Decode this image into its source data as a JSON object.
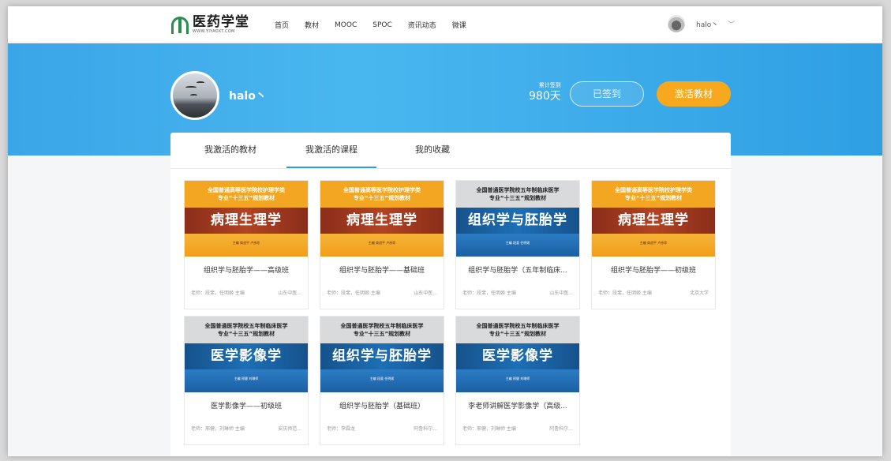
{
  "nav": {
    "logo_cn": "医药学堂",
    "logo_url": "WWW.YIYAOXT.COM",
    "links": [
      "首页",
      "教材",
      "MOOC",
      "SPOC",
      "资讯动态",
      "微课"
    ],
    "username": "halo丶"
  },
  "banner": {
    "username": "halo丶",
    "sign_label": "累计签到",
    "sign_days": "980天",
    "signed_label": "已签到",
    "activate_label": "激活教材"
  },
  "tabs": [
    "我激活的教材",
    "我激活的课程",
    "我的收藏"
  ],
  "active_tab": "我激活的课程",
  "courses": [
    {
      "cover_style": "orange",
      "cover_top": "全国普通高等医学院校护理学类\n专业“十三五”规划教材",
      "cover_title": "病理生理学",
      "cover_authors": "主编 商战平 卢彦珍",
      "title": "组织学与胚胎学——高级班",
      "teacher": "老师：段斐，任明姬 主编",
      "school": "山东中医..."
    },
    {
      "cover_style": "orange",
      "cover_top": "全国普通高等医学院校护理学类\n专业“十三五”规划教材",
      "cover_title": "病理生理学",
      "cover_authors": "主编 商战平 卢彦珍",
      "title": "组织学与胚胎学——基础班",
      "teacher": "老师：段斐，任明姬 主编",
      "school": "山东中医..."
    },
    {
      "cover_style": "blue",
      "cover_top": "全国普通医学院校五年制临床医学\n专业“十三五”规划教材",
      "cover_title": "组织学与胚胎学",
      "cover_authors": "主编 段斐 任明姬",
      "title": "组织学与胚胎学（五年制临床...",
      "teacher": "老师：段斐，任明姬 主编",
      "school": "山东中医..."
    },
    {
      "cover_style": "orange",
      "cover_top": "全国普通高等医学院校护理学类\n专业“十三五”规划教材",
      "cover_title": "病理生理学",
      "cover_authors": "主编 商战平 卢彦珍",
      "title": "组织学与胚胎学——初级班",
      "teacher": "老师：段斐，任明姬 主编",
      "school": "北京大学"
    },
    {
      "cover_style": "blue",
      "cover_top": "全国普通医学院校五年制临床医学\n专业“十三五”规划教材",
      "cover_title": "医学影像学",
      "cover_authors": "主编 邢健 刘琳师",
      "title": "医学影像学——初级班",
      "teacher": "老师：邢健，刘琳师 主编",
      "school": "安庆师范..."
    },
    {
      "cover_style": "blue",
      "cover_top": "全国普通医学院校五年制临床医学\n专业“十三五”规划教材",
      "cover_title": "组织学与胚胎学",
      "cover_authors": "主编 段斐 任明姬",
      "title": "组织学与胚胎学（基础班）",
      "teacher": "老师：李霖龙",
      "school": "阿鲁科尔..."
    },
    {
      "cover_style": "blue",
      "cover_top": "全国普通医学院校五年制临床医学\n专业“十三五”规划教材",
      "cover_title": "医学影像学",
      "cover_authors": "主编 邢健 刘琳师",
      "title": "李老师讲解医学影像学（高级...",
      "teacher": "老师：邢健，刘琳师 主编",
      "school": "阿鲁科尔..."
    }
  ]
}
